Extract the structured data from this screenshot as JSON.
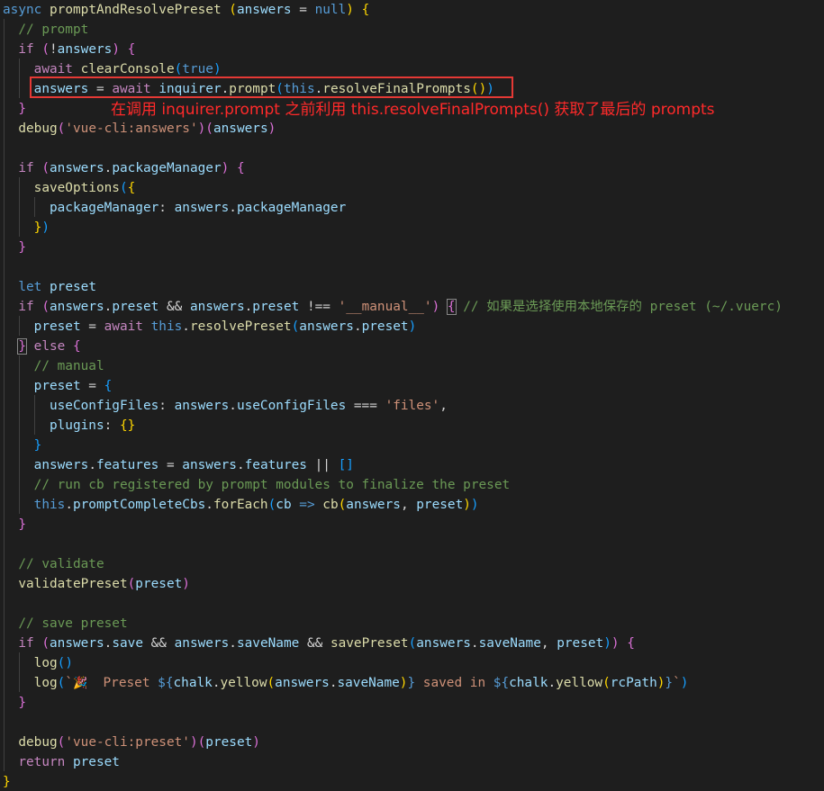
{
  "code": {
    "l1": {
      "kw": "async",
      "fn": "promptAndResolvePreset",
      "param": "answers",
      "eq": " = ",
      "val": "null",
      "tail": ") "
    },
    "l2": {
      "text": "// prompt"
    },
    "l3": {
      "kw": "if",
      "bang": "!",
      "var": "answers"
    },
    "l4": {
      "kw": "await",
      "fn": "clearConsole",
      "val": "true"
    },
    "l5": {
      "var": "answers",
      "eq": " = ",
      "kw": "await",
      "obj": "inquirer",
      "dot": ".",
      "fn": "prompt",
      "this": "this",
      "fn2": "resolveFinalPrompts"
    },
    "l7": {
      "fn": "debug",
      "str": "'vue-cli:answers'",
      "var": "answers"
    },
    "l9": {
      "kw": "if",
      "obj": "answers",
      "prop": "packageManager"
    },
    "l10": {
      "fn": "saveOptions"
    },
    "l11": {
      "key": "packageManager",
      "colon": ": ",
      "obj": "answers",
      "prop": "packageManager"
    },
    "l14": {
      "kw": "let",
      "var": "preset"
    },
    "l15": {
      "kw": "if",
      "obj": "answers",
      "prop": "preset",
      "and": " && ",
      "obj2": "answers",
      "prop2": "preset",
      "neq": " !== ",
      "str": "'__manual__'",
      "comment": "// 如果是选择使用本地保存的 preset (~/.vuerc)"
    },
    "l16": {
      "var": "preset",
      "eq": " = ",
      "kw": "await",
      "this": "this",
      "fn": "resolvePreset",
      "obj": "answers",
      "prop": "preset"
    },
    "l17": {
      "kw": "else"
    },
    "l18": {
      "text": "// manual"
    },
    "l19": {
      "var": "preset",
      "eq": " = "
    },
    "l20": {
      "key": "useConfigFiles",
      "colon": ": ",
      "obj": "answers",
      "prop": "useConfigFiles",
      "op": " === ",
      "str": "'files'",
      "comma": ","
    },
    "l21": {
      "key": "plugins",
      "colon": ": ",
      "braces": "{}",
      "comma": ","
    },
    "l23": {
      "obj": "answers",
      "prop": "features",
      "eq": " = ",
      "obj2": "answers",
      "prop2": "features",
      "or": " || ",
      "arr": "[]"
    },
    "l24": {
      "text": "// run cb registered by prompt modules to finalize the preset"
    },
    "l25": {
      "this": "this",
      "prop": "promptCompleteCbs",
      "fn": "forEach",
      "p": "cb",
      "arrow": "=>",
      "fn2": "cb",
      "a1": "answers",
      "a2": "preset"
    },
    "l28": {
      "text": "// validate"
    },
    "l29": {
      "fn": "validatePreset",
      "var": "preset"
    },
    "l31": {
      "text": "// save preset"
    },
    "l32": {
      "kw": "if",
      "obj": "answers",
      "prop": "save",
      "and": " && ",
      "obj2": "answers",
      "prop2": "saveName",
      "and2": " && ",
      "fn": "savePreset",
      "obj3": "answers",
      "prop3": "saveName",
      "var": "preset"
    },
    "l33": {
      "fn": "log"
    },
    "l34": {
      "fn": "log",
      "emoji": "🎉",
      "s1": "  Preset ",
      "chalk": "chalk",
      "yellow": "yellow",
      "obj": "answers",
      "prop": "saveName",
      "s2": " saved in ",
      "chalk2": "chalk",
      "yellow2": "yellow",
      "rc": "rcPath"
    },
    "l37": {
      "fn": "debug",
      "str": "'vue-cli:preset'",
      "var": "preset"
    },
    "l38": {
      "kw": "return",
      "var": "preset"
    }
  },
  "annotation": "在调用 inquirer.prompt 之前利用 this.resolveFinalPrompts() 获取了最后的 prompts",
  "colors": {
    "background": "#1e1e1e",
    "keyword": "#569cd6",
    "control": "#c586c0",
    "function": "#dcdcaa",
    "variable": "#9cdcfe",
    "string": "#ce9178",
    "comment": "#6a9955",
    "annotation": "#ff2a2a"
  }
}
